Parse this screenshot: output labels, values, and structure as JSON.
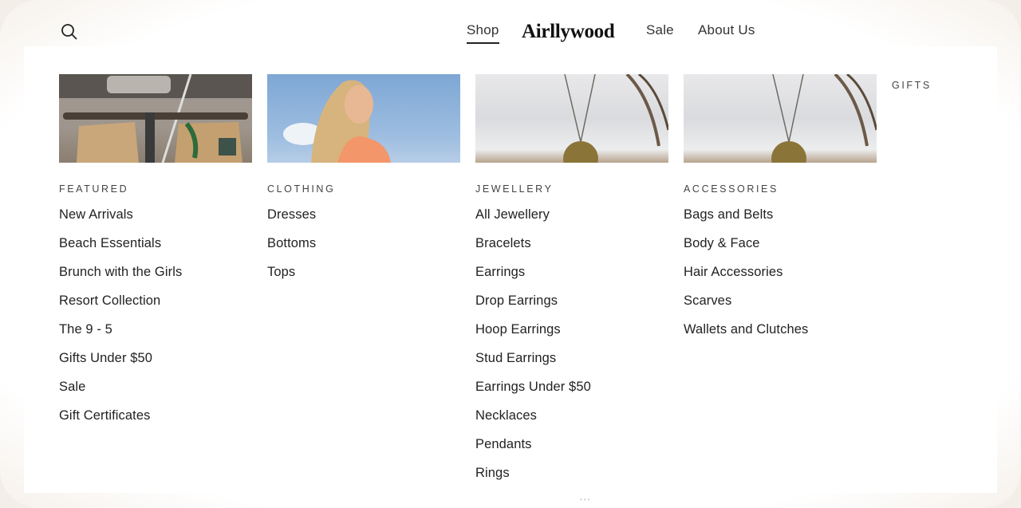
{
  "header": {
    "search_icon": "search-icon",
    "nav": {
      "shop": "Shop",
      "logo": "Airllywood",
      "sale": "Sale",
      "about": "About Us"
    }
  },
  "menu": {
    "columns": [
      {
        "heading": "FEATURED",
        "image": "bicycle-with-shopping-bags",
        "links": [
          "New Arrivals",
          "Beach Essentials",
          "Brunch with the Girls",
          "Resort Collection",
          "The 9 - 5",
          "Gifts Under $50",
          "Sale",
          "Gift Certificates"
        ]
      },
      {
        "heading": "CLOTHING",
        "image": "smiling-woman-blue-sky",
        "links": [
          "Dresses",
          "Bottoms",
          "Tops"
        ]
      },
      {
        "heading": "JEWELLERY",
        "image": "pendant-necklace",
        "links": [
          "All Jewellery",
          "Bracelets",
          "Earrings",
          "Drop Earrings",
          "Hoop Earrings",
          "Stud Earrings",
          "Earrings Under $50",
          "Necklaces",
          "Pendants",
          "Rings"
        ]
      },
      {
        "heading": "ACCESSORIES",
        "image": "pendant-necklace",
        "links": [
          "Bags and Belts",
          "Body & Face",
          "Hair Accessories",
          "Scarves",
          "Wallets and Clutches"
        ]
      }
    ],
    "gifts": "GIFTS"
  }
}
